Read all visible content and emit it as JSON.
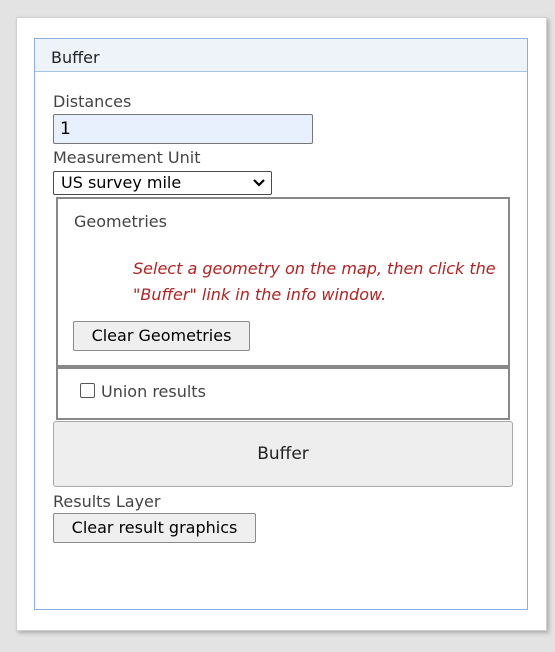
{
  "widget": {
    "title": "Buffer"
  },
  "distances": {
    "label": "Distances",
    "value": "1"
  },
  "unit": {
    "label": "Measurement Unit",
    "selected": "US survey mile"
  },
  "geometries": {
    "title": "Geometries",
    "message": "Select a geometry on the map, then click the \"Buffer\" link in the info window.",
    "clear_label": "Clear Geometries"
  },
  "union": {
    "label": "Union results",
    "checked": false
  },
  "buffer_button": {
    "label": "Buffer"
  },
  "results": {
    "label": "Results Layer",
    "clear_label": "Clear result graphics"
  },
  "colors": {
    "message": "#b22222",
    "title_bar": "#eef3fa",
    "widget_border": "#8ab1dd"
  },
  "icons": {
    "select_arrow": "chevron-down-icon",
    "checkbox": "checkbox-icon"
  }
}
